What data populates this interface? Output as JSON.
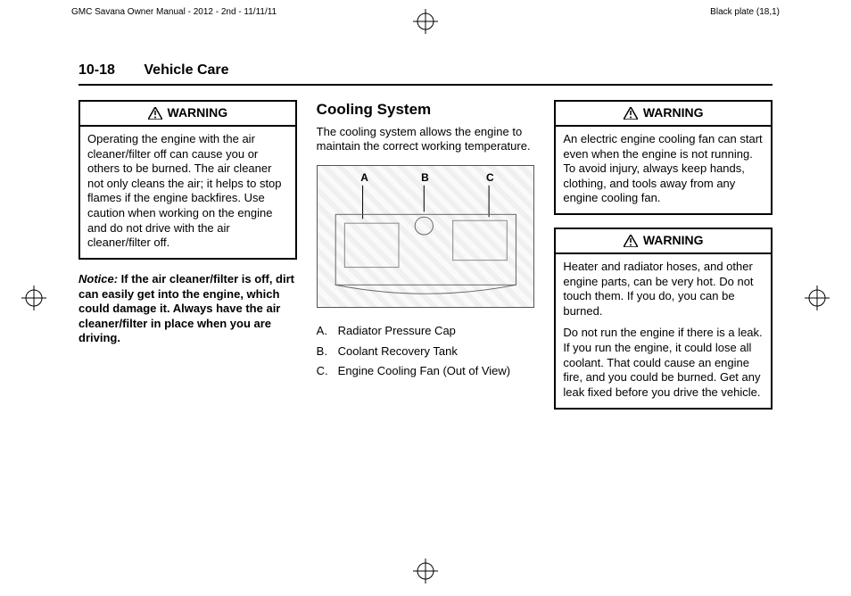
{
  "header": {
    "manual_title": "GMC Savana Owner Manual - 2012 - 2nd - 11/11/11",
    "plate": "Black plate (18,1)"
  },
  "page": {
    "number": "10-18",
    "section": "Vehicle Care"
  },
  "col1": {
    "warning_label": "WARNING",
    "warning_body": "Operating the engine with the air cleaner/filter off can cause you or others to be burned. The air cleaner not only cleans the air; it helps to stop flames if the engine backfires. Use caution when working on the engine and do not drive with the air cleaner/filter off.",
    "notice_lead": "Notice:",
    "notice_body": " If the air cleaner/filter is off, dirt can easily get into the engine, which could damage it. Always have the air cleaner/filter in place when you are driving."
  },
  "col2": {
    "subhead": "Cooling System",
    "intro": "The cooling system allows the engine to maintain the correct working temperature.",
    "labels": {
      "a": "A",
      "b": "B",
      "c": "C"
    },
    "legend": [
      {
        "letter": "A.",
        "text": "Radiator Pressure Cap"
      },
      {
        "letter": "B.",
        "text": "Coolant Recovery Tank"
      },
      {
        "letter": "C.",
        "text": "Engine Cooling Fan (Out of View)"
      }
    ]
  },
  "col3": {
    "warning_label": "WARNING",
    "warning1_body": "An electric engine cooling fan can start even when the engine is not running. To avoid injury, always keep hands, clothing, and tools away from any engine cooling fan.",
    "warning2_p1": "Heater and radiator hoses, and other engine parts, can be very hot. Do not touch them. If you do, you can be burned.",
    "warning2_p2": "Do not run the engine if there is a leak. If you run the engine, it could lose all coolant. That could cause an engine fire, and you could be burned. Get any leak fixed before you drive the vehicle."
  }
}
